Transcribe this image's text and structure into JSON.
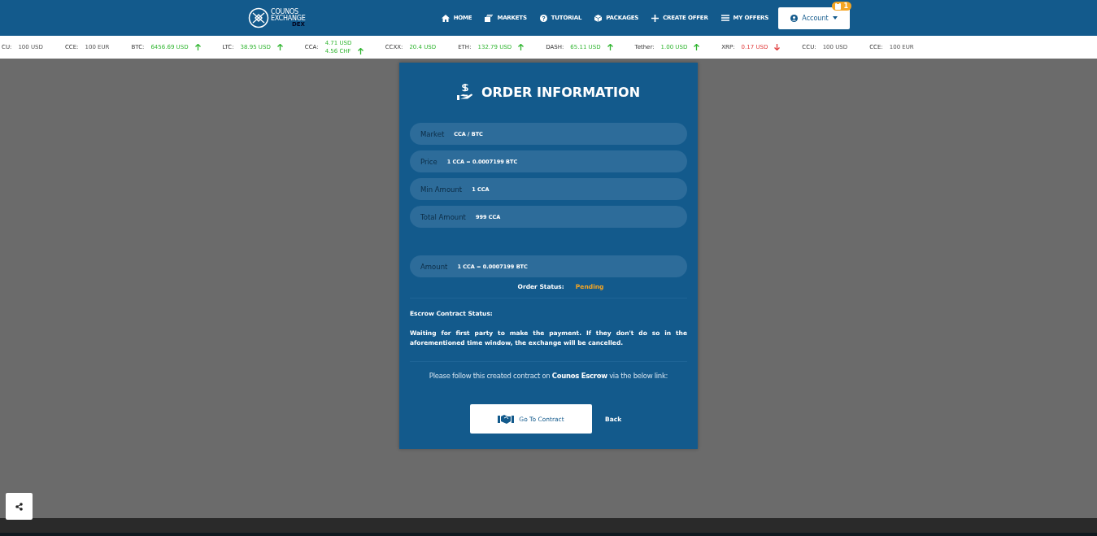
{
  "header": {
    "logo": {
      "line1": "COUNOS",
      "line2": "EXCHANGE",
      "sub": "DEX"
    },
    "nav": [
      {
        "label": "HOME",
        "kind": "home"
      },
      {
        "label": "MARKETS",
        "kind": "markets"
      },
      {
        "label": "TUTORIAL",
        "kind": "tutorial"
      },
      {
        "label": "PACKAGES",
        "kind": "packages"
      },
      {
        "label": "CREATE OFFER",
        "kind": "create"
      },
      {
        "label": "MY OFFERS",
        "kind": "offers"
      }
    ],
    "account": {
      "label": "Account",
      "badge": "1"
    }
  },
  "ticker": [
    {
      "symbol": "CU:",
      "values": [
        "100 USD"
      ],
      "kind": "neutral"
    },
    {
      "symbol": "CCE:",
      "values": [
        "100 EUR"
      ],
      "kind": "neutral"
    },
    {
      "symbol": "BTC:",
      "values": [
        "6456.69 USD"
      ],
      "kind": "rising"
    },
    {
      "symbol": "LTC:",
      "values": [
        "38.95 USD"
      ],
      "kind": "rising"
    },
    {
      "symbol": "CCA:",
      "values": [
        "4.71 USD",
        "4.56 CHF"
      ],
      "kind": "rising"
    },
    {
      "symbol": "CCXX:",
      "values": [
        "20.4 USD"
      ],
      "kind": "steady"
    },
    {
      "symbol": "ETH:",
      "values": [
        "132.79 USD"
      ],
      "kind": "rising"
    },
    {
      "symbol": "DASH:",
      "values": [
        "65.11 USD"
      ],
      "kind": "rising"
    },
    {
      "symbol": "Tether:",
      "values": [
        "1.00 USD"
      ],
      "kind": "rising"
    },
    {
      "symbol": "XRP:",
      "values": [
        "0.17 USD"
      ],
      "kind": "falling"
    },
    {
      "symbol": "CCU:",
      "values": [
        "100 USD"
      ],
      "kind": "neutral"
    },
    {
      "symbol": "CCE:",
      "values": [
        "100 EUR"
      ],
      "kind": "neutral"
    }
  ],
  "card": {
    "title": "ORDER INFORMATION",
    "fields": [
      {
        "label": "Market",
        "value": "CCA / BTC"
      },
      {
        "label": "Price",
        "value": "1 CCA = 0.0007199 BTC"
      },
      {
        "label": "Min Amount",
        "value": "1 CCA"
      },
      {
        "label": "Total Amount",
        "value": "999 CCA"
      }
    ],
    "amount": {
      "label": "Amount",
      "value": "1 CCA = 0.0007199 BTC"
    },
    "order_status": {
      "label": "Order Status:",
      "value": "Pending"
    },
    "escrow_heading": "Escrow Contract Status:",
    "escrow_text": "Waiting for first party to make the payment. If they don't do so in the aforementioned time window, the exchange will be cancelled.",
    "follow_text": "Please follow this created contract on **Counos Escrow** via the below link:",
    "buttons": {
      "contract": "Go To Contract",
      "back": "Back"
    }
  }
}
